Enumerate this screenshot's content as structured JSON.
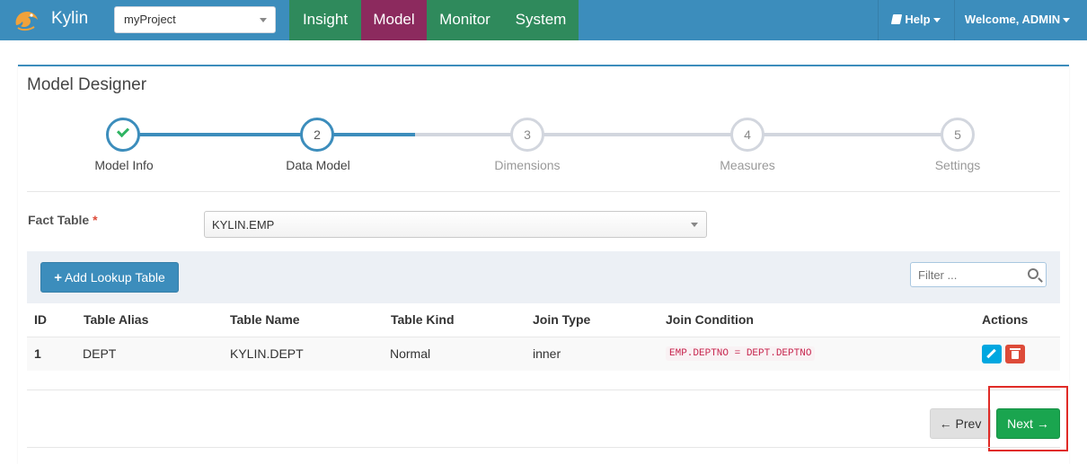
{
  "navbar": {
    "brand": "Kylin",
    "project": "myProject",
    "tabs": [
      "Insight",
      "Model",
      "Monitor",
      "System"
    ],
    "active_tab": "Model",
    "help": "Help",
    "welcome": "Welcome, ADMIN"
  },
  "page": {
    "title": "Model Designer"
  },
  "wizard": {
    "steps": [
      {
        "number": "1",
        "label": "Model Info",
        "state": "done"
      },
      {
        "number": "2",
        "label": "Data Model",
        "state": "active"
      },
      {
        "number": "3",
        "label": "Dimensions",
        "state": "todo"
      },
      {
        "number": "4",
        "label": "Measures",
        "state": "todo"
      },
      {
        "number": "5",
        "label": "Settings",
        "state": "todo"
      }
    ]
  },
  "fact_table": {
    "label": "Fact Table",
    "required_mark": "*",
    "value": "KYLIN.EMP"
  },
  "lookup": {
    "add_label": "Add Lookup Table",
    "filter_placeholder": "Filter ...",
    "columns": [
      "ID",
      "Table Alias",
      "Table Name",
      "Table Kind",
      "Join Type",
      "Join Condition",
      "Actions"
    ],
    "rows": [
      {
        "id": "1",
        "alias": "DEPT",
        "name": "KYLIN.DEPT",
        "kind": "Normal",
        "join_type": "inner",
        "condition": "EMP.DEPTNO = DEPT.DEPTNO"
      }
    ]
  },
  "footer": {
    "prev_label": "Prev",
    "next_label": "Next"
  },
  "colors": {
    "navbar": "#3c8dbc",
    "tab_green": "#2f8a5c",
    "tab_active": "#8c2a5e",
    "next_green": "#1aa54f",
    "highlight_red": "#e02b27"
  }
}
